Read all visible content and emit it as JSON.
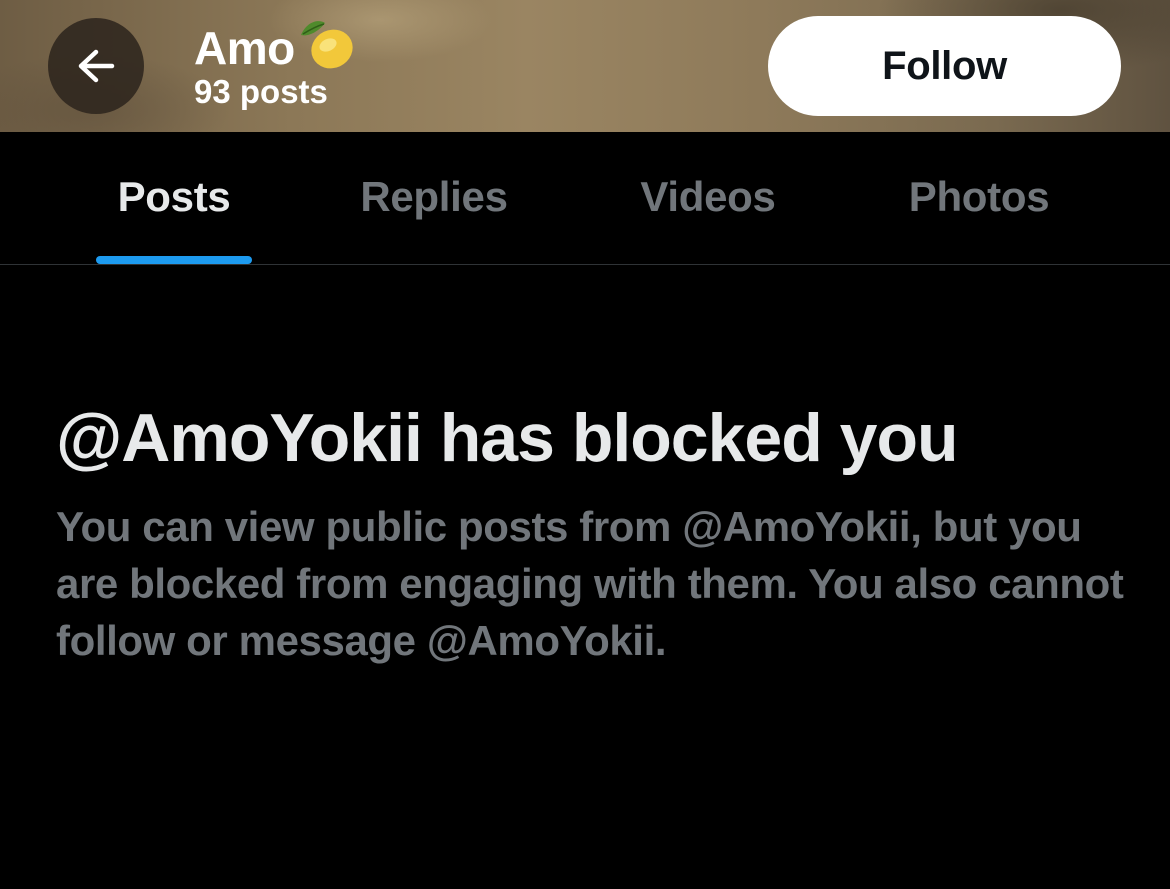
{
  "header": {
    "display_name": "Amo",
    "post_count": "93 posts",
    "follow_label": "Follow",
    "back_icon": "arrow-left-icon",
    "name_emoji_icon": "lemon-icon"
  },
  "tabs": [
    {
      "label": "Posts",
      "active": true
    },
    {
      "label": "Replies",
      "active": false
    },
    {
      "label": "Videos",
      "active": false
    },
    {
      "label": "Photos",
      "active": false
    }
  ],
  "notice": {
    "title": "@AmoYokii has blocked you",
    "body": "You can view public posts from @AmoYokii, but you are blocked from engaging with them. You also cannot follow or message @AmoYokii."
  },
  "colors": {
    "background": "#000000",
    "primary_text": "#e7e9ea",
    "secondary_text": "#71767b",
    "accent": "#1d9bf0",
    "follow_button_bg": "#ffffff",
    "follow_button_text": "#0f1419"
  }
}
